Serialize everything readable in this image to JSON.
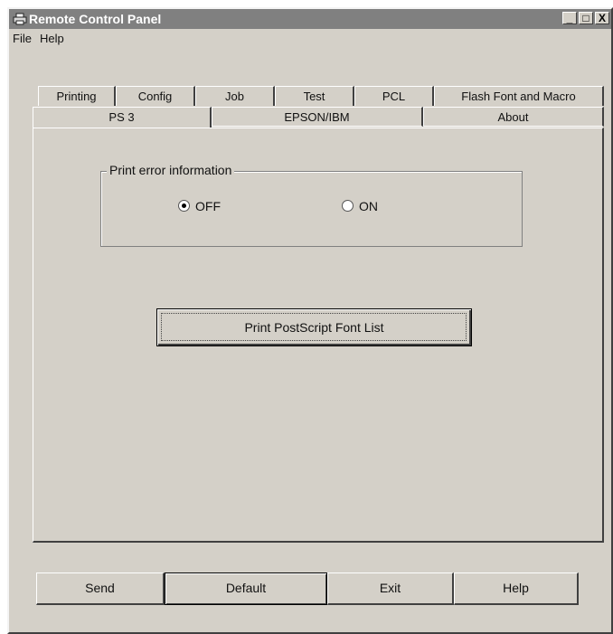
{
  "window": {
    "title": "Remote Control Panel",
    "icon": "printer-icon"
  },
  "controls": {
    "minimize": "_",
    "maximize": "□",
    "close": "X"
  },
  "menu": {
    "file": "File",
    "help": "Help"
  },
  "tabs_back": [
    "Printing",
    "Config",
    "Job",
    "Test",
    "PCL",
    "Flash Font and Macro"
  ],
  "tabs_front": [
    "PS 3",
    "EPSON/IBM",
    "About"
  ],
  "active_tab": "PS 3",
  "print_error": {
    "label": "Print error information",
    "options": [
      "OFF",
      "ON"
    ],
    "selected": "OFF"
  },
  "font_list_button": "Print PostScript Font List",
  "bottom_buttons": {
    "send": "Send",
    "default": "Default",
    "exit": "Exit",
    "help": "Help"
  }
}
